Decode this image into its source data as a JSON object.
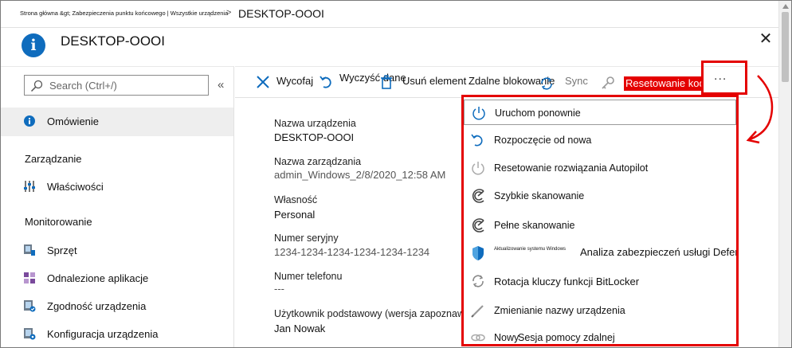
{
  "breadcrumb": {
    "path_small": "Strona główna &gt; Zabezpieczenia punktu końcowego | Wszystkie urządzenia",
    "separator": ">",
    "current": "DESKTOP-OOOI"
  },
  "header": {
    "title": "DESKTOP-OOOI",
    "icon": "info-icon",
    "icon_glyph": "i",
    "close_glyph": "✕"
  },
  "search": {
    "placeholder": "Search (Ctrl+/)",
    "value": "",
    "collapse_glyph": "«"
  },
  "nav": {
    "overview": "Omówienie",
    "group_manage": "Zarządzanie",
    "properties": "Właściwości",
    "group_monitor": "Monitorowanie",
    "hardware": "Sprzęt",
    "discovered_apps": "Odnalezione aplikacje",
    "device_compliance": "Zgodność urządzenia",
    "device_config": "Konfiguracja urządzenia"
  },
  "toolbar": {
    "retire": "Wycofaj",
    "wipe": "Wyczyść dane",
    "delete": "Usuń element",
    "remote_lock": "Zdalne blokowanie",
    "sync": "Sync",
    "reset_passcode": "Resetowanie kodu",
    "more": "..."
  },
  "details": {
    "device_name_label": "Nazwa urządzenia",
    "device_name": "DESKTOP-OOOI",
    "management_name_label": "Nazwa zarządzania",
    "management_name": "admin_Windows_2/8/2020_12:58 AM",
    "ownership_label": "Własność",
    "ownership": "Personal",
    "serial_label": "Numer seryjny",
    "serial": "1234-1234-1234-1234-1234-1234",
    "phone_label": "Numer telefonu",
    "phone": "---",
    "primary_user_label": "Użytkownik podstawowy (wersja zapoznawcza)",
    "primary_user": "Jan Nowak"
  },
  "menu": {
    "restart": "Uruchom ponownie",
    "fresh_start": "Rozpoczęcie od nowa",
    "autopilot_reset": "Resetowanie rozwiązania Autopilot",
    "quick_scan": "Szybkie skanowanie",
    "full_scan": "Pełne skanowanie",
    "update_windows_small": "Aktualizowanie systemu Windows",
    "defender_analysis": "Analiza zabezpieczeń usługi Defender",
    "bitlocker": "Rotacja kluczy funkcji BitLocker",
    "rename": "Zmienianie nazwy urządzenia",
    "new_prefix": "Nowy",
    "remote_help": "Sesja pomocy zdalnej"
  },
  "colors": {
    "accent": "#0f6cbd",
    "highlight_red": "#e40000",
    "selected_nav_bg": "#eeeeee"
  }
}
